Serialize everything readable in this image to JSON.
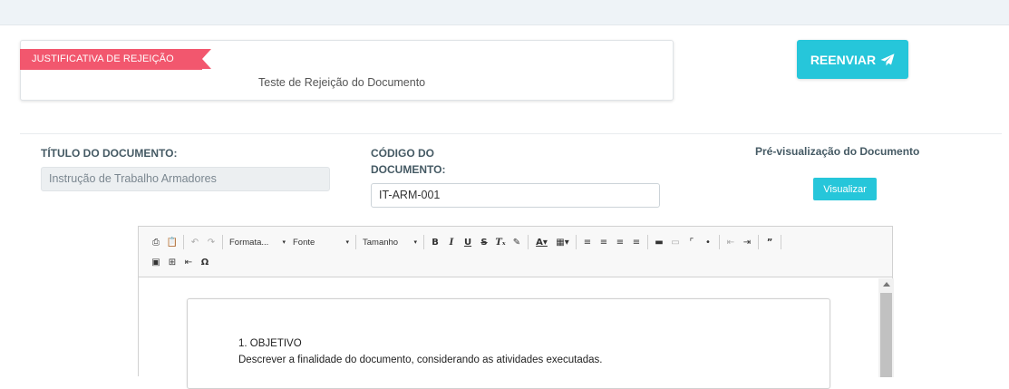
{
  "rejection": {
    "badge": "JUSTIFICATIVA DE REJEIÇÃO",
    "text": "Teste de Rejeição do Documento"
  },
  "resend_button": {
    "label": "REENVIAR",
    "icon": "paper-plane-icon"
  },
  "form": {
    "title_label": "TÍTULO DO DOCUMENTO:",
    "title_value": "Instrução de Trabalho Armadores",
    "code_label_line1": "CÓDIGO DO",
    "code_label_line2": "DOCUMENTO:",
    "code_value": "IT-ARM-001",
    "preview_label": "Pré-visualização do Documento",
    "preview_button": "Visualizar"
  },
  "editor": {
    "format_combo": "Formata...",
    "font_combo": "Fonte",
    "size_combo": "Tamanho",
    "content": {
      "heading": "1. OBJETIVO",
      "paragraph": "Descrever a finalidade do documento, considerando as atividades executadas."
    }
  },
  "colors": {
    "accent": "#26c6da",
    "ribbon": "#f2576e",
    "label": "#455a64"
  }
}
